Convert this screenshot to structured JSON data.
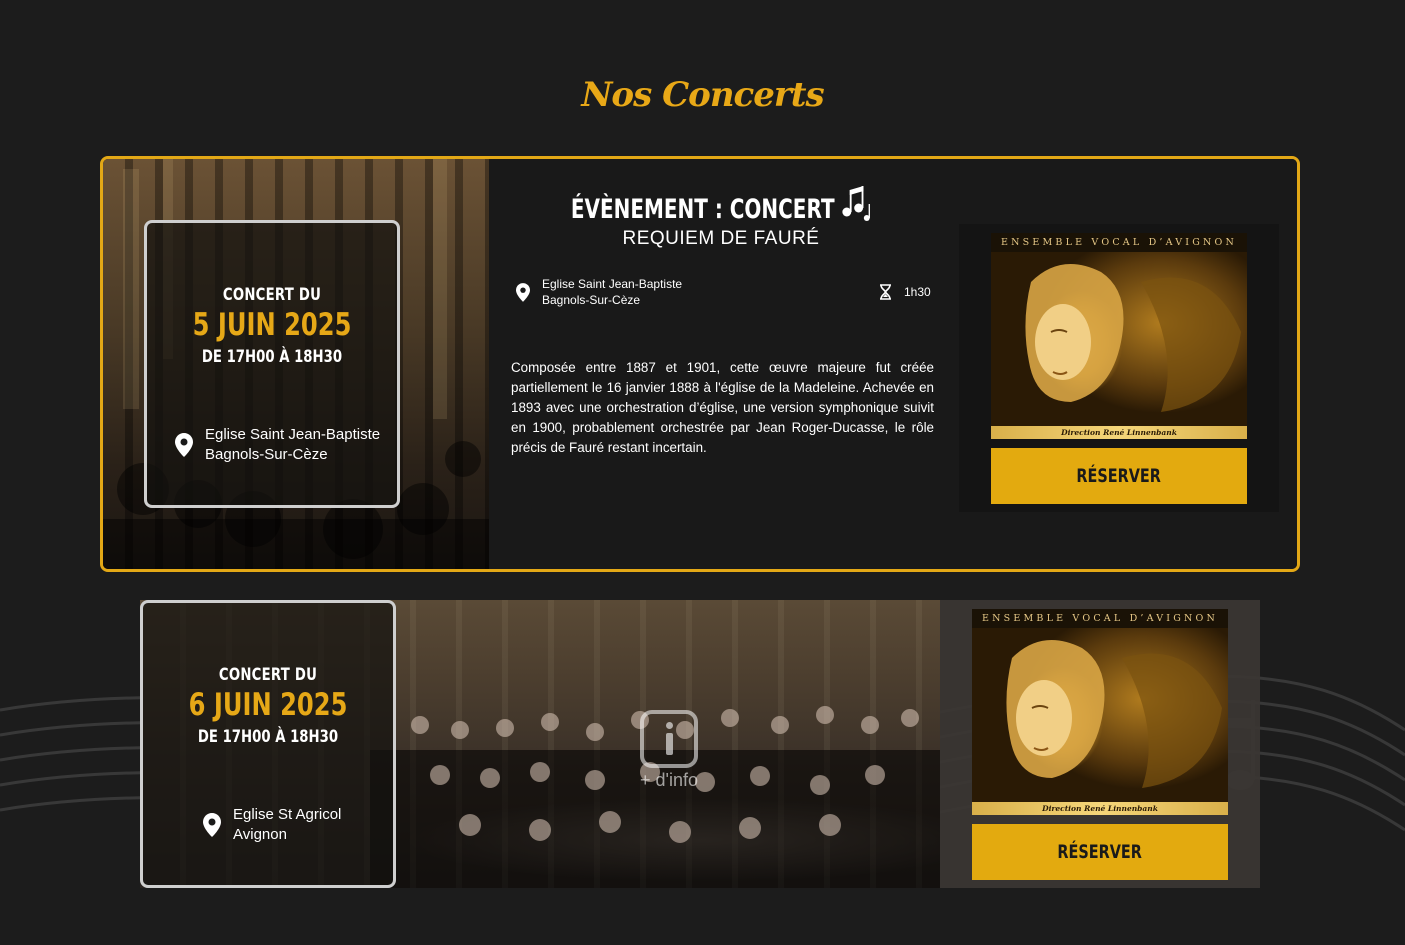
{
  "page": {
    "title": "Nos Concerts"
  },
  "concerts": [
    {
      "label": "CONCERT DU",
      "date": "5 JUIN 2025",
      "time": "DE 17H00 À 18H30",
      "location_line1": "Eglise Saint Jean-Baptiste",
      "location_line2": "Bagnols-Sur-Cèze",
      "event_title": "ÉVÈNEMENT : CONCERT",
      "event_subtitle": "REQUIEM DE FAURÉ",
      "meta_location_line1": "Eglise Saint Jean-Baptiste",
      "meta_location_line2": "Bagnols-Sur-Cèze",
      "duration": "1h30",
      "description": "Composée entre 1887 et 1901, cette œuvre majeure fut créée partiellement le 16 janvier 1888 à l'église de la Madeleine. Achevée en 1893 avec une orchestration d’église, une version symphonique suivit en 1900, probablement orchestrée par Jean Roger-Ducasse, le rôle précis de Fauré restant incertain.",
      "cover_band": "ENSEMBLE VOCAL D’AVIGNON",
      "cover_credit": "Direction René Linnenbank",
      "button": "RÉSERVER"
    },
    {
      "label": "CONCERT DU",
      "date": "6 JUIN 2025",
      "time": "DE 17H00 À 18H30",
      "location_line1": "Eglise St Agricol",
      "location_line2": "Avignon",
      "more_info": "+ d'info",
      "cover_band": "ENSEMBLE VOCAL D’AVIGNON",
      "cover_credit": "Direction René Linnenbank",
      "button": "RÉSERVER"
    }
  ],
  "icons": {
    "location": "map-pin-icon",
    "duration": "hourglass-icon",
    "music": "music-notes-icon",
    "info": "info-icon"
  },
  "colors": {
    "accent": "#e3aa0f",
    "background": "#1c1c1c",
    "card_border": "#e3a816"
  }
}
